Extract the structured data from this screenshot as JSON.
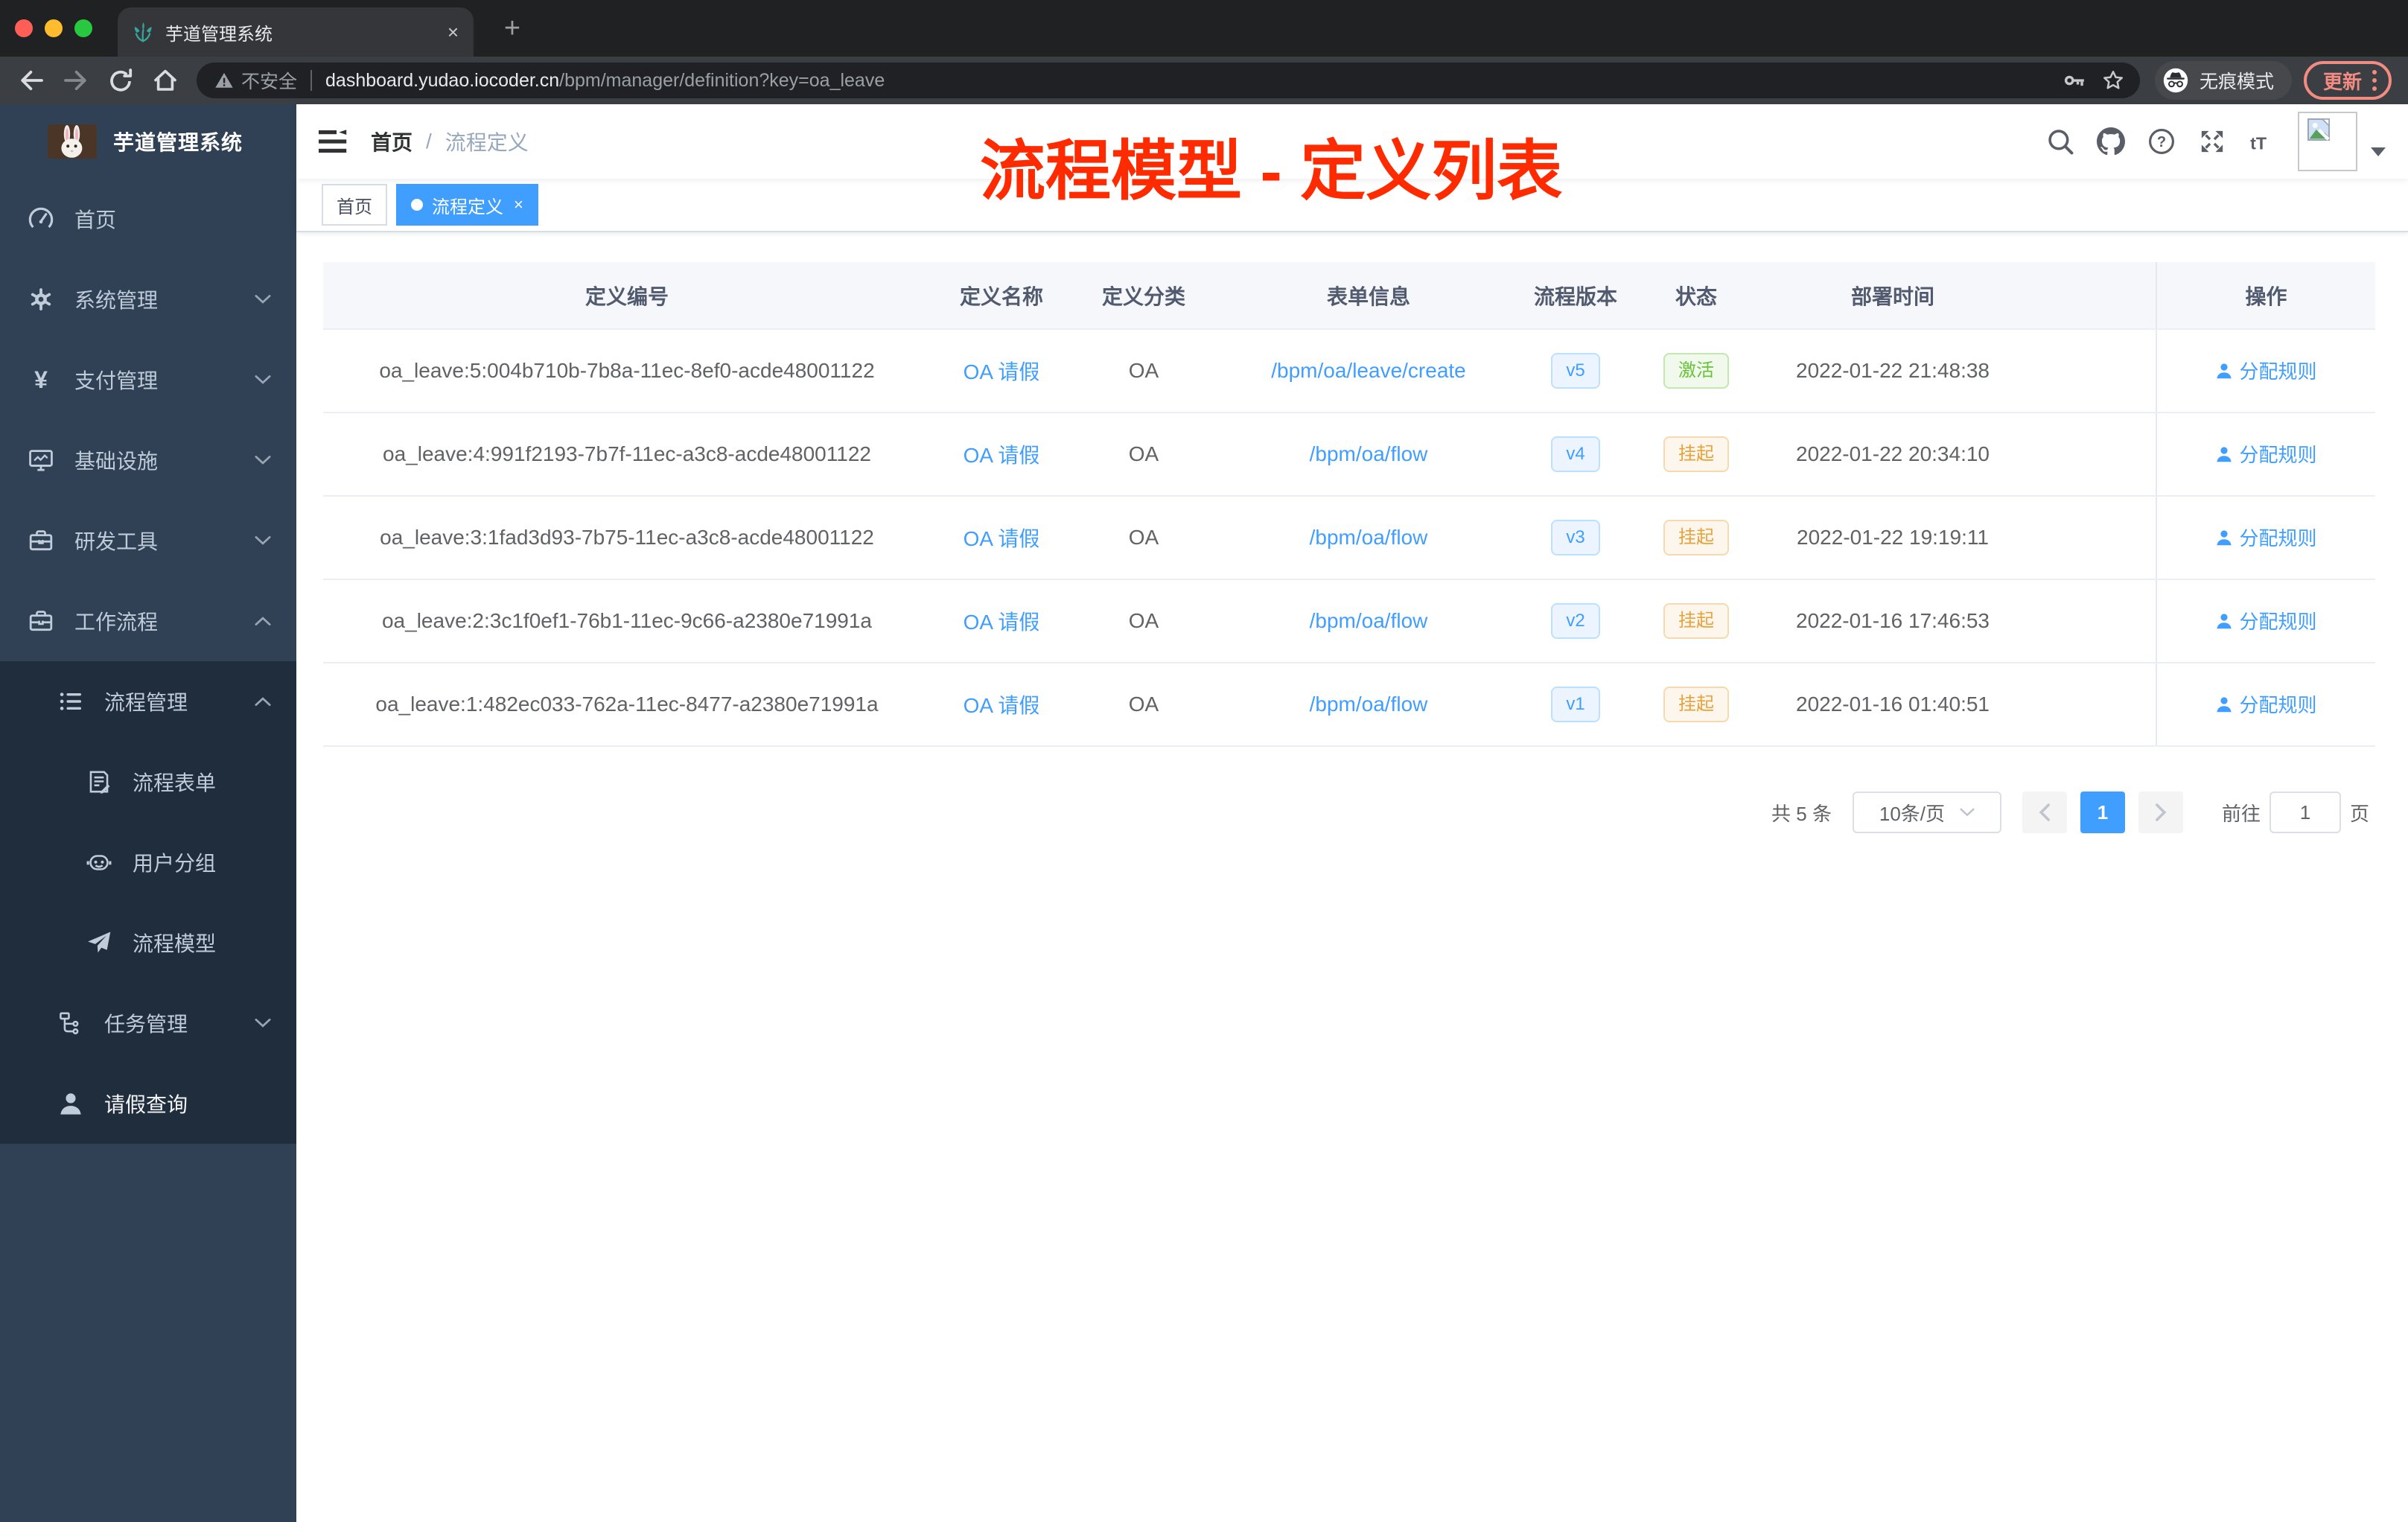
{
  "browser": {
    "tab_title": "芋道管理系统",
    "security_label": "不安全",
    "url_host": "dashboard.yudao.iocoder.cn",
    "url_path": "/bpm/manager/definition?key=oa_leave",
    "incognito_label": "无痕模式",
    "update_label": "更新"
  },
  "sidebar": {
    "logo_title": "芋道管理系统",
    "menu": [
      {
        "label": "首页",
        "icon": "dashboard",
        "level": 1
      },
      {
        "label": "系统管理",
        "icon": "gear",
        "level": 1,
        "chevron": "down"
      },
      {
        "label": "支付管理",
        "icon": "yen",
        "level": 1,
        "chevron": "down"
      },
      {
        "label": "基础设施",
        "icon": "monitor",
        "level": 1,
        "chevron": "down"
      },
      {
        "label": "研发工具",
        "icon": "toolbox",
        "level": 1,
        "chevron": "down"
      },
      {
        "label": "工作流程",
        "icon": "briefcase",
        "level": 1,
        "chevron": "up"
      },
      {
        "label": "流程管理",
        "icon": "list",
        "level": 2,
        "chevron": "up",
        "in_submenu": true
      },
      {
        "label": "流程表单",
        "icon": "form",
        "level": 3,
        "in_submenu": true
      },
      {
        "label": "用户分组",
        "icon": "robot",
        "level": 3,
        "in_submenu": true
      },
      {
        "label": "流程模型",
        "icon": "send",
        "level": 3,
        "in_submenu": true
      },
      {
        "label": "任务管理",
        "icon": "tree",
        "level": 2,
        "chevron": "down",
        "in_submenu": true
      },
      {
        "label": "请假查询",
        "icon": "user",
        "level": 2,
        "in_submenu": true,
        "highlight": true
      }
    ]
  },
  "navbar": {
    "breadcrumb": [
      "首页",
      "流程定义"
    ],
    "annotation": "流程模型 - 定义列表"
  },
  "tags": [
    {
      "label": "首页",
      "active": false,
      "closable": false
    },
    {
      "label": "流程定义",
      "active": true,
      "closable": true
    }
  ],
  "table": {
    "columns": [
      "定义编号",
      "定义名称",
      "定义分类",
      "表单信息",
      "流程版本",
      "状态",
      "部署时间",
      "操作"
    ],
    "action_label": "分配规则",
    "rows": [
      {
        "id": "oa_leave:5:004b710b-7b8a-11ec-8ef0-acde48001122",
        "name": "OA 请假",
        "category": "OA",
        "form": "/bpm/oa/leave/create",
        "version": "v5",
        "status": "激活",
        "status_type": "success",
        "deploy_time": "2022-01-22 21:48:38"
      },
      {
        "id": "oa_leave:4:991f2193-7b7f-11ec-a3c8-acde48001122",
        "name": "OA 请假",
        "category": "OA",
        "form": "/bpm/oa/flow",
        "version": "v4",
        "status": "挂起",
        "status_type": "warning",
        "deploy_time": "2022-01-22 20:34:10"
      },
      {
        "id": "oa_leave:3:1fad3d93-7b75-11ec-a3c8-acde48001122",
        "name": "OA 请假",
        "category": "OA",
        "form": "/bpm/oa/flow",
        "version": "v3",
        "status": "挂起",
        "status_type": "warning",
        "deploy_time": "2022-01-22 19:19:11"
      },
      {
        "id": "oa_leave:2:3c1f0ef1-76b1-11ec-9c66-a2380e71991a",
        "name": "OA 请假",
        "category": "OA",
        "form": "/bpm/oa/flow",
        "version": "v2",
        "status": "挂起",
        "status_type": "warning",
        "deploy_time": "2022-01-16 17:46:53"
      },
      {
        "id": "oa_leave:1:482ec033-762a-11ec-8477-a2380e71991a",
        "name": "OA 请假",
        "category": "OA",
        "form": "/bpm/oa/flow",
        "version": "v1",
        "status": "挂起",
        "status_type": "warning",
        "deploy_time": "2022-01-16 01:40:51"
      }
    ]
  },
  "pagination": {
    "total_label": "共 5 条",
    "page_size": "10条/页",
    "current_page": "1",
    "goto_label": "前往",
    "goto_value": "1",
    "page_unit": "页"
  },
  "colors": {
    "accent": "#409eff",
    "annotation_red": "#fe2b00",
    "success": "#67c23a",
    "warning": "#e6a23c",
    "sidebar_bg": "#304156",
    "submenu_bg": "#1f2d3d",
    "active_tag": "#409eff"
  }
}
